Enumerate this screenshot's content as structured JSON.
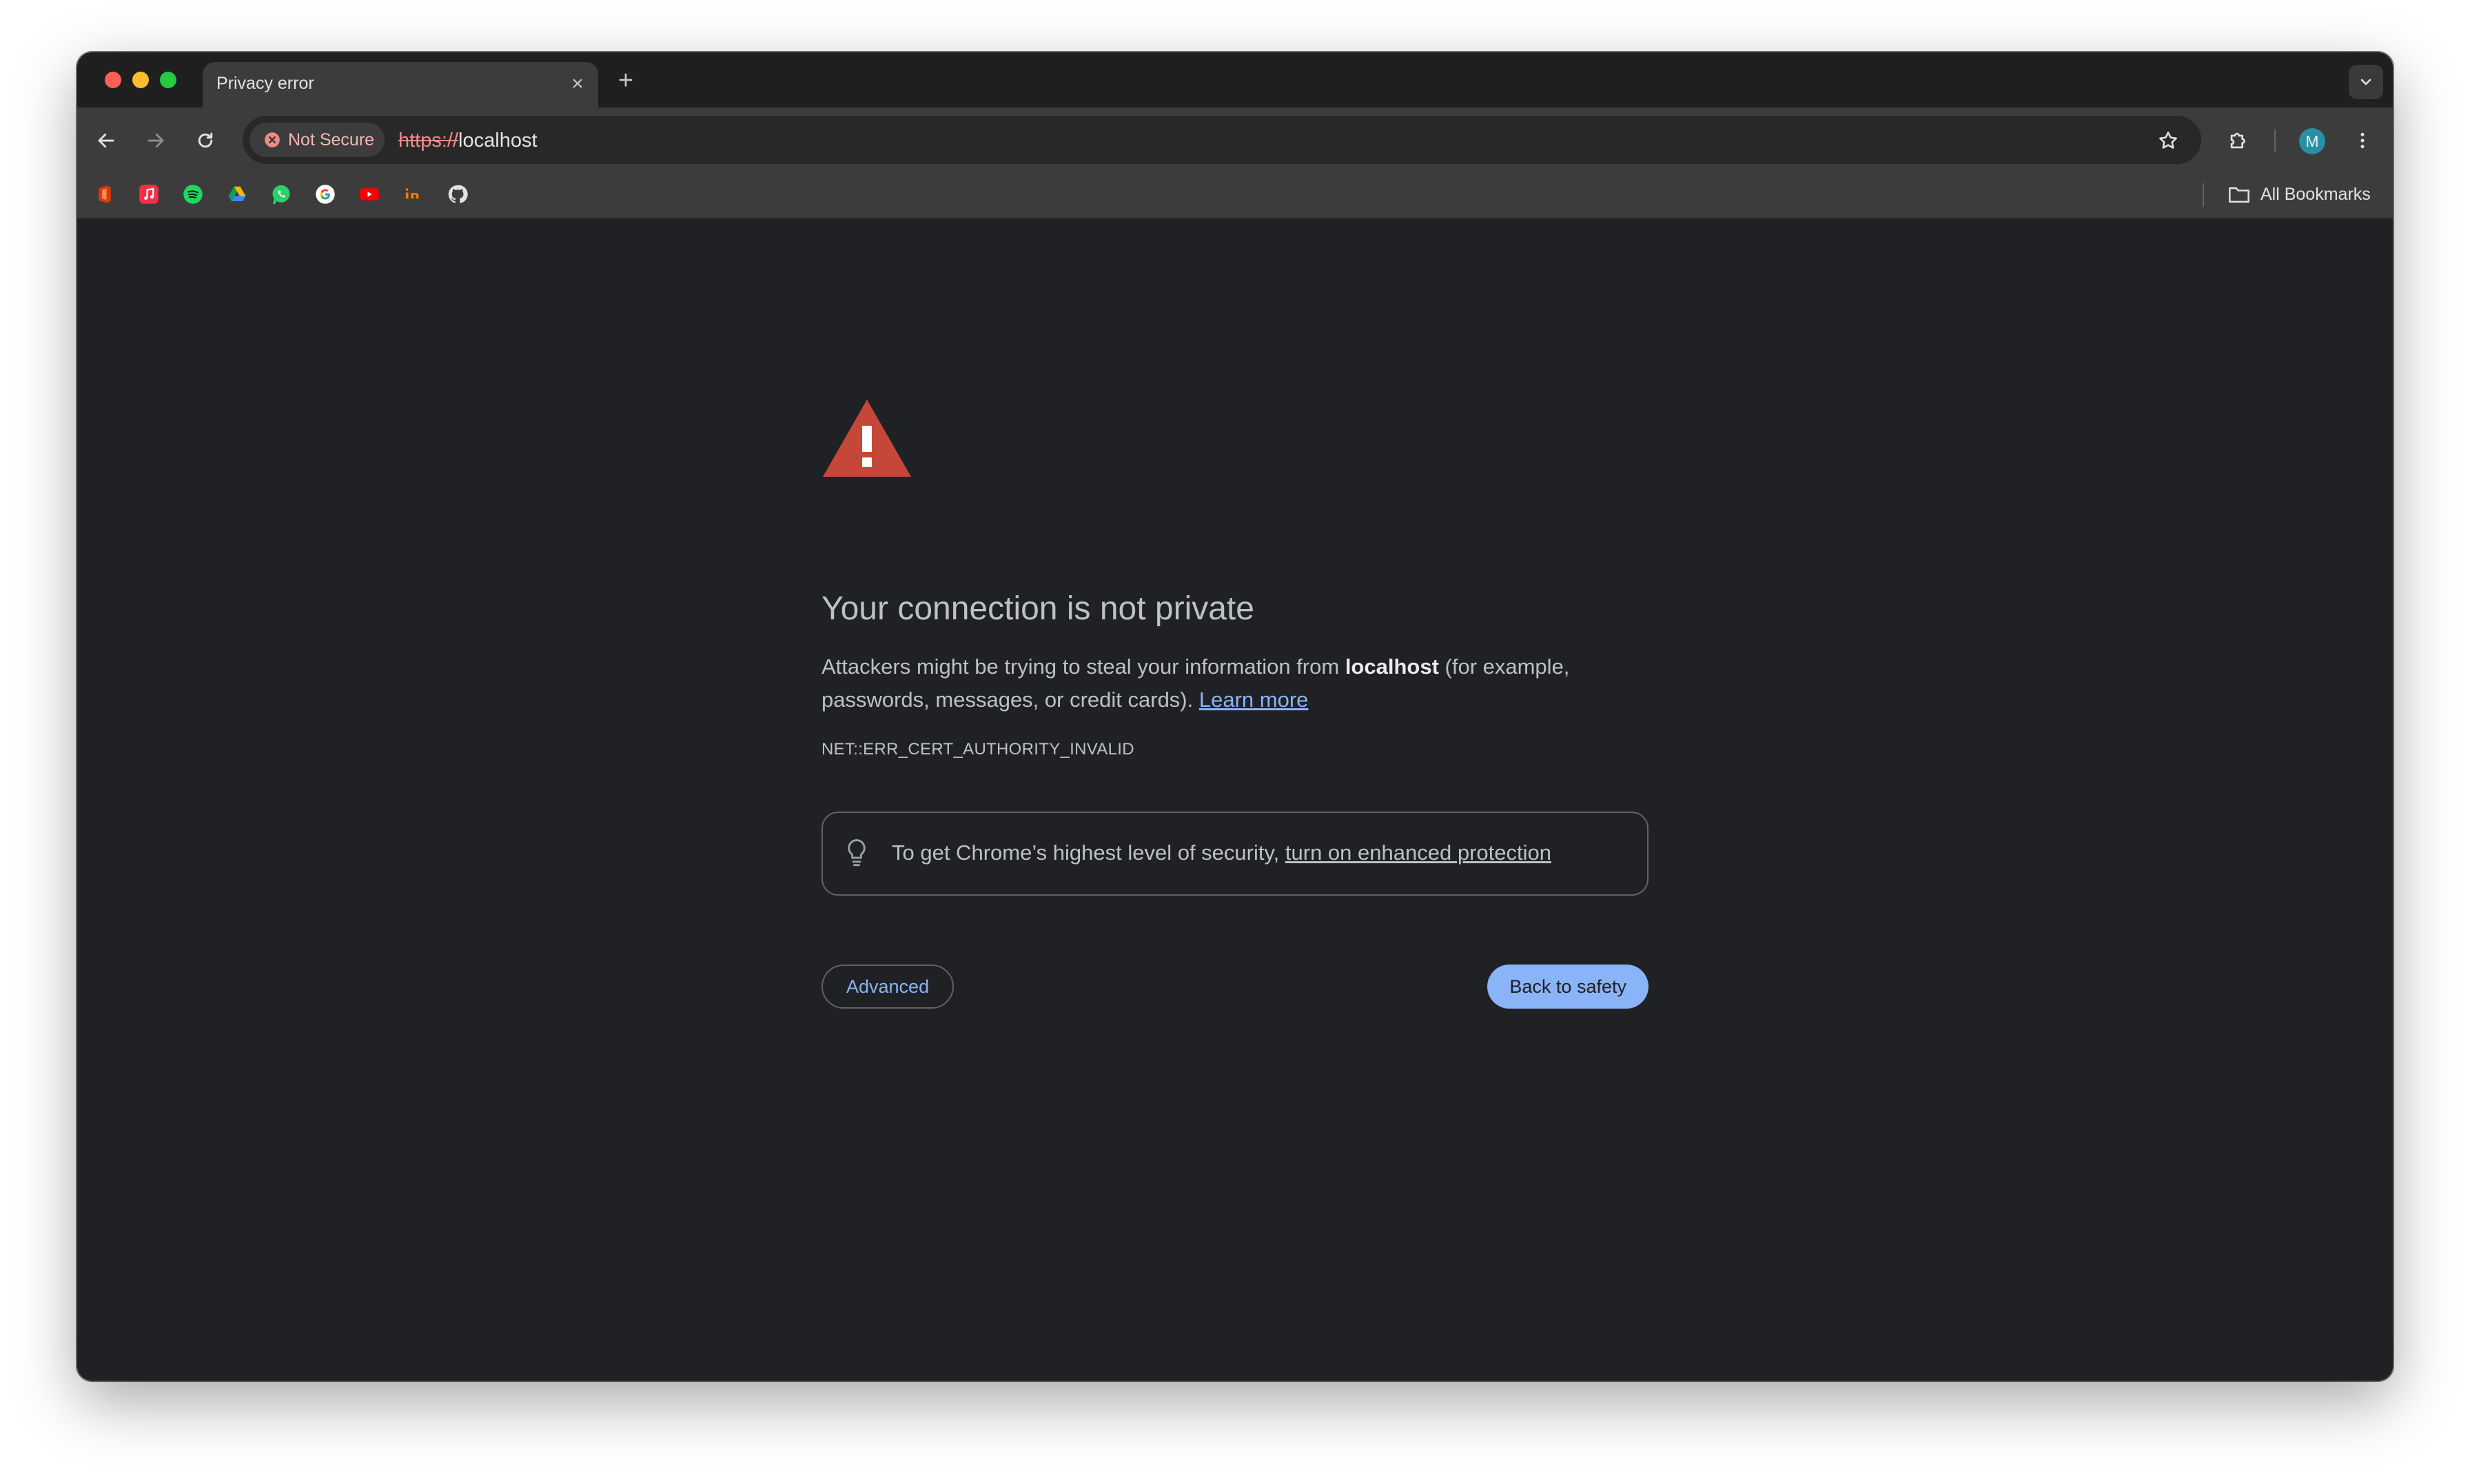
{
  "window": {
    "controls": [
      "close",
      "minimize",
      "maximize"
    ]
  },
  "tab": {
    "title": "Privacy error",
    "close": "×"
  },
  "newtab": {
    "label": "+"
  },
  "toolbar": {
    "security_chip": "Not Secure",
    "url_scheme": "https://",
    "url_host": "localhost",
    "avatar_initial": "M"
  },
  "bookmarks": {
    "icons": [
      "office-icon",
      "apple-music-icon",
      "spotify-icon",
      "google-drive-icon",
      "whatsapp-icon",
      "google-icon",
      "youtube-icon",
      "interaction-icon",
      "github-icon"
    ],
    "all_bookmarks_label": "All Bookmarks"
  },
  "page": {
    "heading": "Your connection is not private",
    "desc_part1": "Attackers might be trying to steal your information from ",
    "desc_host": "localhost",
    "desc_part2": " (for example, passwords, messages, or credit cards). ",
    "learn_more": "Learn more",
    "error_code": "NET::ERR_CERT_AUTHORITY_INVALID",
    "security_text": "To get Chrome’s highest level of security, ",
    "security_link": "turn on enhanced protection",
    "advanced_button": "Advanced",
    "safety_button": "Back to safety"
  },
  "colors": {
    "page_bg": "#202124",
    "toolbar_bg": "#3c3c3c",
    "accent_blue": "#8ab4f8",
    "warning_red": "#c5473a",
    "not_secure_red": "#f28b82"
  }
}
